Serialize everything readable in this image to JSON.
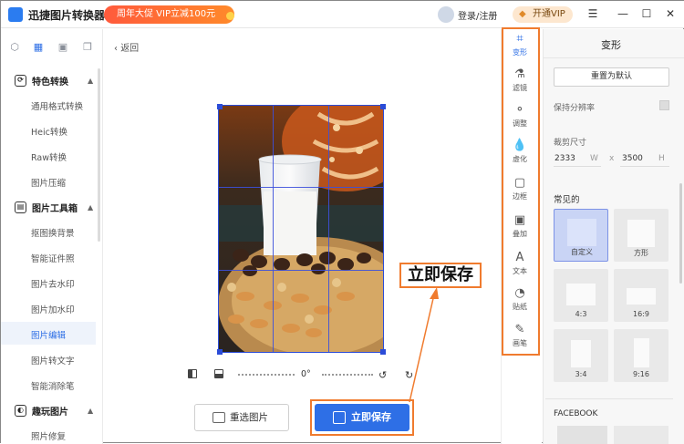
{
  "app": {
    "name": "迅捷图片转换器",
    "promo": "周年大促 VIP立减100元",
    "login": "登录/注册",
    "vip": "开通VIP"
  },
  "window": {
    "menu": "☰",
    "minimize": "—",
    "maximize": "☐",
    "close": "✕"
  },
  "sidebar": {
    "sections": [
      {
        "label": "特色转换",
        "items": [
          "通用格式转换",
          "Heic转换",
          "Raw转换",
          "图片压缩"
        ]
      },
      {
        "label": "图片工具箱",
        "items": [
          "抠图换背景",
          "智能证件照",
          "图片去水印",
          "图片加水印",
          "图片编辑",
          "图片转文字",
          "智能消除笔"
        ]
      },
      {
        "label": "趣玩图片",
        "items": [
          "照片修复"
        ]
      }
    ]
  },
  "nav": {
    "back": "返回"
  },
  "editor": {
    "rotation": "0°"
  },
  "buttons": {
    "reselect": "重选图片",
    "save": "立即保存"
  },
  "callout": "立即保存",
  "tools": [
    "变形",
    "滤镜",
    "调整",
    "虚化",
    "边框",
    "叠加",
    "文本",
    "贴纸",
    "画笔"
  ],
  "panel": {
    "title": "变形",
    "reset": "重置为默认",
    "keep_resolution": "保持分辨率",
    "crop_size": "裁剪尺寸",
    "width": "2333",
    "width_unit": "W",
    "times": "x",
    "height": "3500",
    "height_unit": "H",
    "common": "常见的",
    "ratios": [
      "自定义",
      "方形",
      "4:3",
      "16:9",
      "3:4",
      "9:16"
    ],
    "facebook": "FACEBOOK"
  },
  "colors": {
    "accent": "#2e6fe6",
    "highlight": "#f07b2e",
    "promo": "#ff5a3c"
  }
}
